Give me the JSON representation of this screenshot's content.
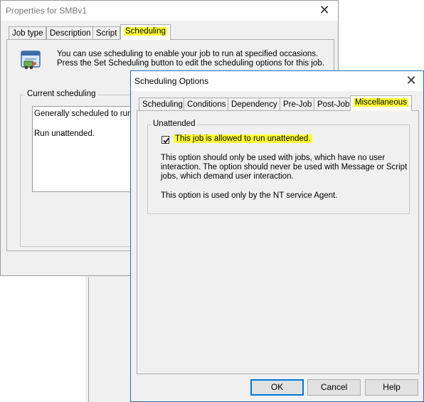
{
  "properties_window": {
    "title": "Properties for SMBv1",
    "tabs": [
      "Job type",
      "Description",
      "Script",
      "Scheduling"
    ],
    "info_line1": "You can use scheduling to enable your job to run at specified occasions.",
    "info_line2": "Press the Set Scheduling button to edit the scheduling options for this job.",
    "current_scheduling_label": "Current scheduling",
    "schedule_line1": "Generally scheduled to run al",
    "schedule_line2": "Run unattended."
  },
  "options_dialog": {
    "title": "Scheduling Options",
    "tabs": [
      "Scheduling",
      "Conditions",
      "Dependency",
      "Pre-Job",
      "Post-Job",
      "Miscellaneous"
    ],
    "group_label": "Unattended",
    "checkbox_label": "This job is allowed to run unattended.",
    "checkbox_checked": true,
    "para1_line1": "This option should only be used with jobs, which have no user",
    "para1_line2": "interaction. The option should never be used with Message or Script",
    "para1_line3": "jobs, which demand user interaction.",
    "para2": "This option is used only by the NT service Agent.",
    "buttons": {
      "ok": "OK",
      "cancel": "Cancel",
      "help": "Help"
    }
  },
  "colors": {
    "highlight": "#ffff33",
    "default_button_border": "#0078d7"
  }
}
